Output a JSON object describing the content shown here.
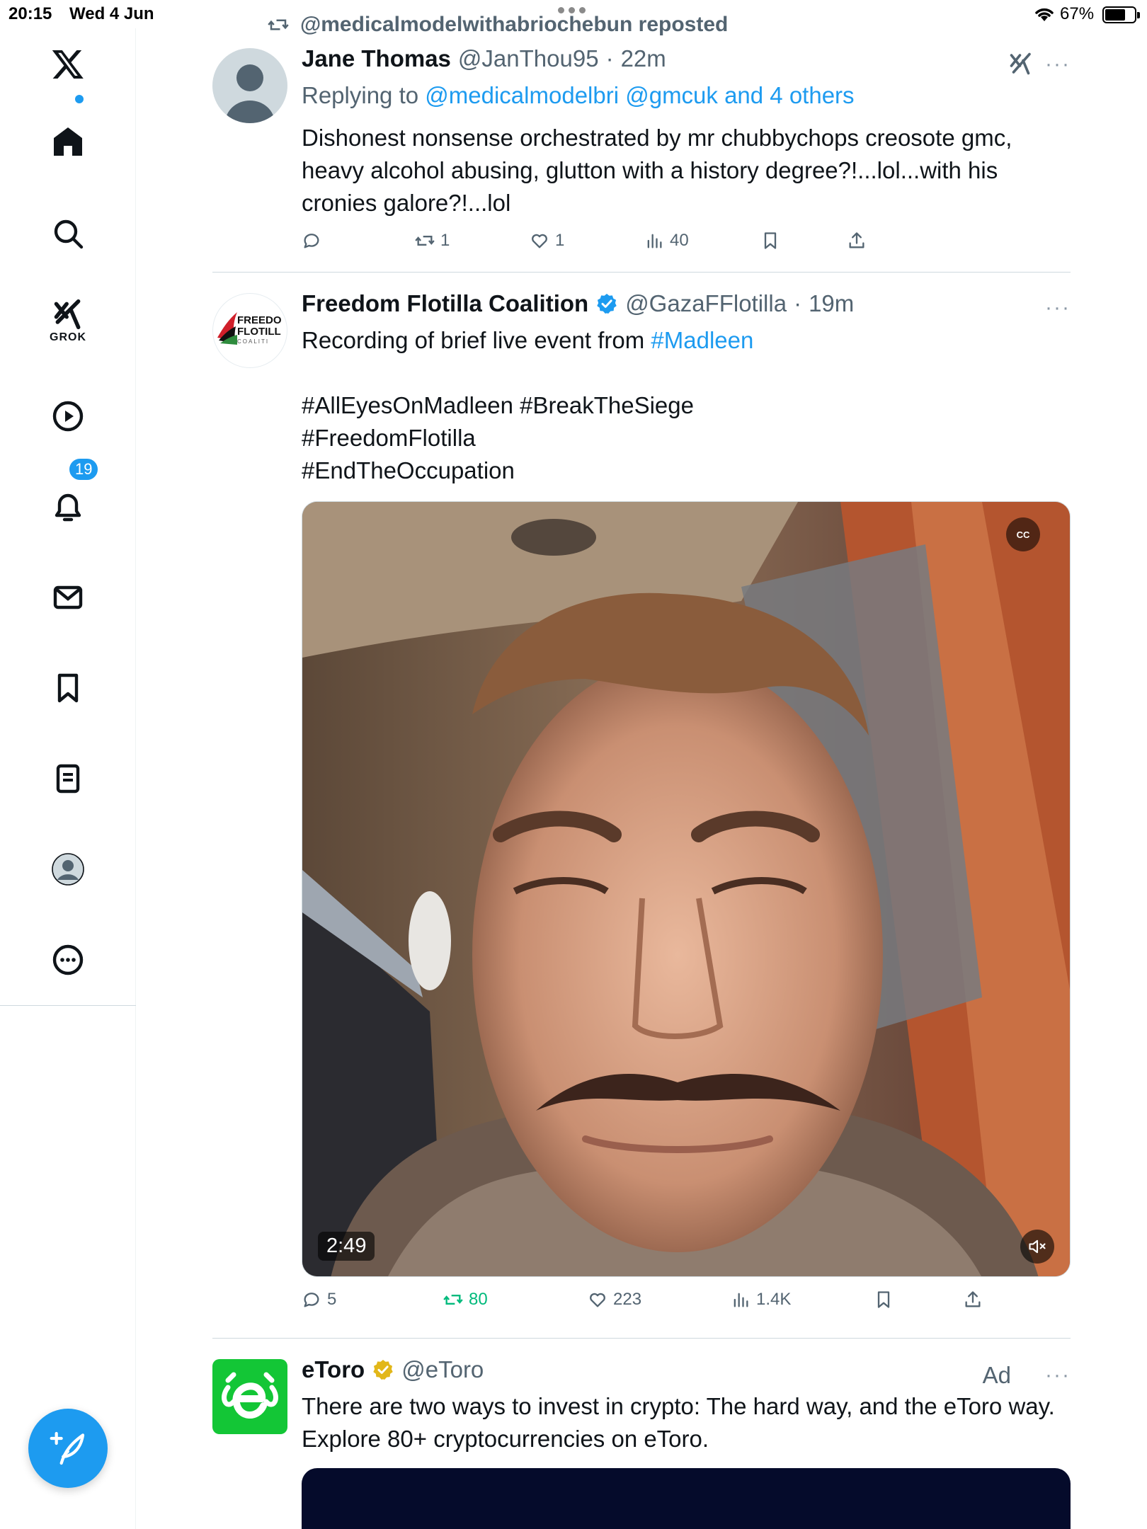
{
  "status_bar": {
    "time": "20:15",
    "date": "Wed 4 Jun",
    "battery_percent": "67%",
    "battery_level": 0.67
  },
  "sidebar": {
    "grok_label": "GROK",
    "notifications_badge": "19",
    "items": [
      "x-logo",
      "home",
      "search",
      "grok",
      "videos",
      "notifications",
      "messages",
      "bookmarks",
      "lists",
      "profile",
      "more"
    ]
  },
  "repost": {
    "text": "@medicalmodelwithabriochebun reposted"
  },
  "tweets": [
    {
      "name": "Jane Thomas",
      "handle": "@JanThou95",
      "sep": "·",
      "time": "22m",
      "more": "···",
      "replying_prefix": "Replying to",
      "replying_to": "@medicalmodelbri @gmcuk and 4 others",
      "text": "Dishonest nonsense orchestrated by mr chubbychops creosote gmc, heavy alcohol abusing, glutton with a history degree?!...lol...with his cronies galore?!...lol",
      "stats": {
        "replies": "",
        "reposts": "1",
        "likes": "1",
        "views": "40"
      }
    },
    {
      "name": "Freedom Flotilla Coalition",
      "handle": "@GazaFFlotilla",
      "sep": "·",
      "time": "19m",
      "more": "···",
      "text_prefix": "Recording of brief live event from",
      "text_tag": "#Madleen",
      "hashtags_line1": "#AllEyesOnMadleen #BreakTheSiege",
      "hashtags_line2": "#FreedomFlotilla",
      "hashtags_line3": "#EndTheOccupation",
      "avatar_text_1": "FREEDO",
      "avatar_text_2": "FLOTILL",
      "avatar_text_3": "COALITI",
      "video": {
        "duration": "2:49",
        "cc": "CC"
      },
      "stats": {
        "replies": "5",
        "reposts": "80",
        "likes": "223",
        "views": "1.4K"
      }
    },
    {
      "name": "eToro",
      "handle": "@eToro",
      "ad_label": "Ad",
      "more": "···",
      "text": "There are two ways to invest in crypto: The hard way, and the eToro way. Explore 80+ cryptocurrencies on eToro."
    }
  ],
  "colors": {
    "accent": "#1d9bf0",
    "repost_green": "#00ba7c",
    "etoro_green": "#13c636",
    "muted": "#536471"
  }
}
